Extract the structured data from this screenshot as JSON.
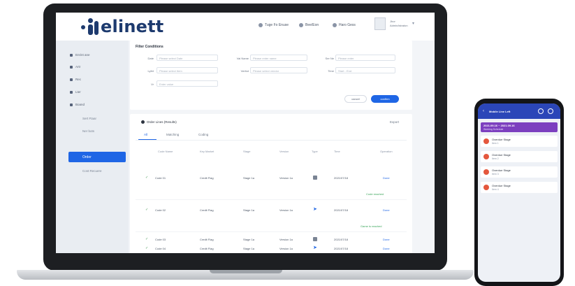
{
  "brand": {
    "logo_text": "elinett",
    "primary_color": "#1d3a6e",
    "accent_color": "#1f66e5",
    "phone_header_color": "#2b46b8",
    "phone_banner_color": "#7c3fbf"
  },
  "header": {
    "links": [
      {
        "label": "Tuge Fo Enuse",
        "icon": "globe-icon"
      },
      {
        "label": "Bee/Eon",
        "icon": "bell-icon"
      },
      {
        "label": "Haro Gess",
        "icon": "edit-icon"
      }
    ],
    "user": {
      "name": "Jhor",
      "role": "Admin/istraton"
    }
  },
  "sidebar": {
    "items": [
      {
        "label": "Enrint ane",
        "icon": "grid-icon"
      },
      {
        "label": "Artr",
        "icon": "user-icon"
      },
      {
        "label": "Rec",
        "icon": "wrench-icon"
      },
      {
        "label": "Lter",
        "icon": "list-icon"
      },
      {
        "label": "Boand",
        "icon": "box-icon"
      }
    ],
    "sub_items": [
      "Sert Ftaar",
      "Ner bots",
      "Order",
      "Cost Recuere"
    ],
    "active_item": "Order"
  },
  "filter": {
    "title": "Filter Conditions",
    "fields": [
      {
        "label": "Date",
        "placeholder": "Please select Date"
      },
      {
        "label": "Lyfet",
        "placeholder": "Please select Item"
      },
      {
        "label": "Vr",
        "placeholder": "Enter value"
      },
      {
        "label": "Vai Name",
        "placeholder": "Please enter name"
      },
      {
        "label": "Veritot",
        "placeholder": "Please select vendor"
      },
      {
        "label": "Ser Ne",
        "placeholder": "Please enter"
      },
      {
        "label": "Time",
        "placeholder": "Start - End"
      }
    ],
    "cancel_label": "cancel",
    "confirm_label": "confirm"
  },
  "table": {
    "title": "Order Lines (Results)",
    "export_label": "Export",
    "tabs": [
      "All",
      "Matching",
      "Coding"
    ],
    "columns": [
      "Code Name",
      "Key Market",
      "Stage",
      "Version",
      "Type",
      "Time",
      "Operation"
    ],
    "rows": [
      {
        "code": "Code 01",
        "market": "Credit Flag",
        "stage": "Stage 1a",
        "version": "Version 1a",
        "type": "lock",
        "time": "2021/07/18",
        "op": "Done"
      },
      {
        "code": "Code 02",
        "market": "Credit Flag",
        "stage": "Stage 1a",
        "version": "Version 1a",
        "type": "fin",
        "time": "2021/07/18",
        "op": "Done"
      },
      {
        "code": "Code 03",
        "market": "Credit Flag",
        "stage": "Stage 1a",
        "version": "Version 1a",
        "type": "lock",
        "time": "2021/07/18",
        "op": "Done"
      },
      {
        "code": "Code 04",
        "market": "Credit Flag",
        "stage": "Stage 1a",
        "version": "Version 1a",
        "type": "fin",
        "time": "2021/07/18",
        "op": "Done"
      }
    ],
    "status_notes": [
      "Code reached",
      "Game is reached"
    ]
  },
  "phone": {
    "header_title": "Mobile Line Left",
    "banner": {
      "title": "2021.09.16 ~ 2021.09.16",
      "subtitle": "Working Schedule"
    },
    "cards": [
      {
        "title": "Overdue Stage",
        "sub": "Item 1"
      },
      {
        "title": "Overdue Stage",
        "sub": "Item 2"
      },
      {
        "title": "Overdue Stage",
        "sub": "Item 3"
      },
      {
        "title": "Overdue Stage",
        "sub": "Item 4"
      }
    ]
  }
}
